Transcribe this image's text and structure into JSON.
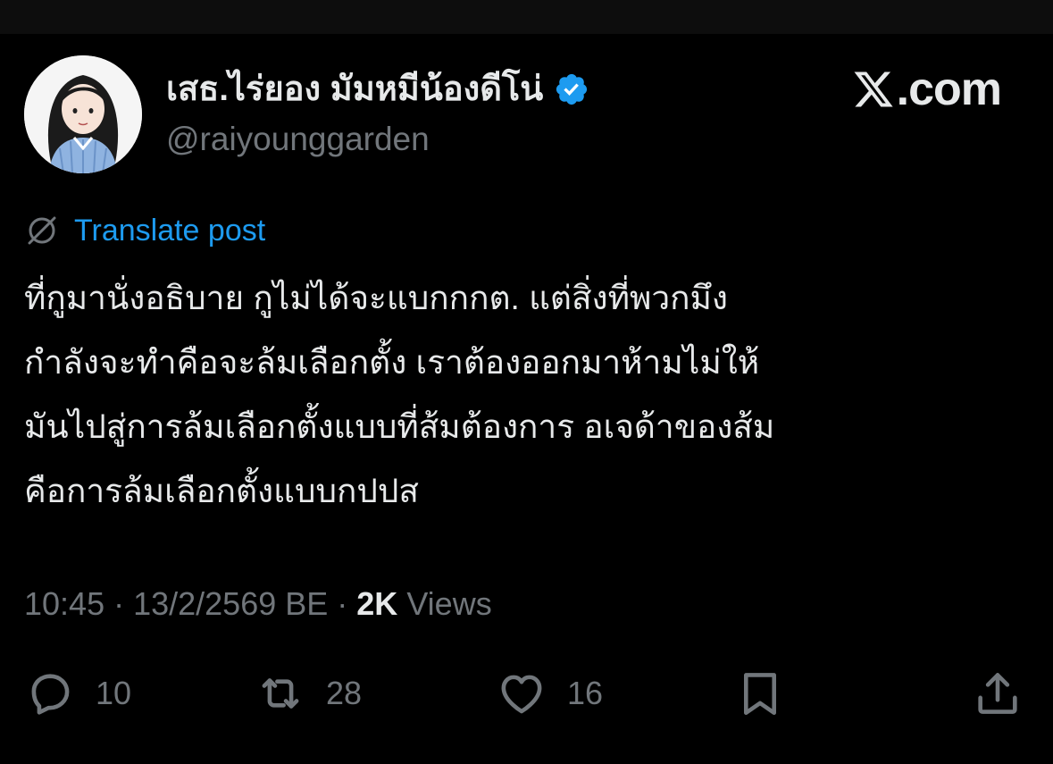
{
  "author": {
    "display_name": "เสธ.ไร่ยอง มัมหมีน้องดีโน่",
    "handle": "@raiyounggarden",
    "verified": true,
    "avatar_icon": "avatar-illustration"
  },
  "brand": {
    "watermark": ".com",
    "logo_icon": "x-logo-icon"
  },
  "post": {
    "translate_label": "Translate post",
    "lines": [
      "ที่กูมานั่งอธิบาย กูไม่ได้จะแบกกกต. แต่สิ่งที่พวกมึง",
      "กำลังจะทำคือจะล้มเลือกตั้ง  เราต้องออกมาห้ามไม่ให้",
      "มันไปสู่การล้มเลือกตั้งแบบที่ส้มต้องการ  อเจด้าของส้ม",
      "คือการล้มเลือกตั้งแบบกปปส"
    ]
  },
  "meta": {
    "time": "10:45",
    "sep1": " · ",
    "date": "13/2/2569 BE",
    "sep2": " · ",
    "views_count": "2K",
    "views_label": " Views"
  },
  "actions": {
    "reply_count": "10",
    "repost_count": "28",
    "like_count": "16"
  },
  "colors": {
    "background": "#000000",
    "text": "#e7e9ea",
    "muted": "#71767b",
    "link": "#1d9bf0",
    "verified": "#1d9bf0"
  }
}
